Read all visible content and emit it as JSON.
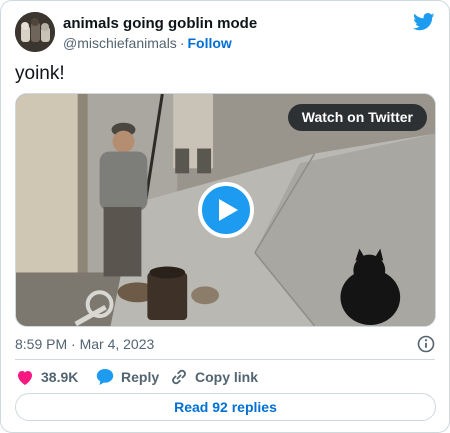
{
  "author": {
    "display_name": "animals going goblin mode",
    "handle": "@mischiefanimals",
    "separator": "·",
    "follow_label": "Follow"
  },
  "tweet": {
    "text": "yoink!",
    "timestamp": "8:59 PM · Mar 4, 2023"
  },
  "media": {
    "watch_label": "Watch on Twitter",
    "play_icon": "play-icon"
  },
  "actions": {
    "like_count": "38.9K",
    "reply_label": "Reply",
    "copy_link_label": "Copy link"
  },
  "footer": {
    "read_replies_label": "Read 92 replies"
  },
  "colors": {
    "twitter_blue": "#1d9bf0",
    "link_blue": "#006fd6",
    "like_pink": "#f91880",
    "muted_text": "#536471",
    "border": "#cfd9de"
  },
  "icons": {
    "brand": "twitter-bird-icon",
    "info": "info-icon",
    "like": "heart-icon",
    "reply": "speech-bubble-icon",
    "copy": "link-icon"
  }
}
